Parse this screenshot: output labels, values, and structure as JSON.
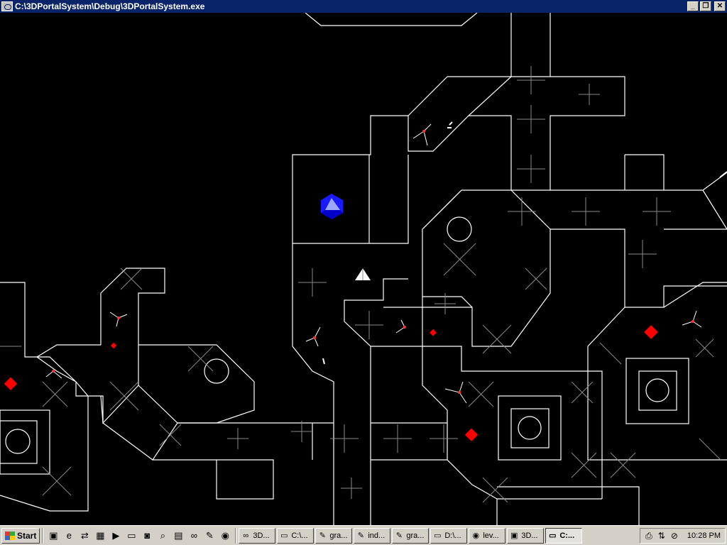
{
  "window": {
    "title": "C:\\3DPortalSystem\\Debug\\3DPortalSystem.exe",
    "minimize_label": "_",
    "maximize_label": "❐",
    "close_label": "✕"
  },
  "scene": {
    "wall_color": "#ffffff",
    "grid_color": "#8a8a8a",
    "enemy_color": "#ff0000",
    "player_color": "#1a1aff"
  },
  "taskbar": {
    "start_label": "Start",
    "quick_launch": [
      {
        "icon": "show-desktop-icon",
        "glyph": "▣"
      },
      {
        "icon": "internet-explorer-icon",
        "glyph": "e"
      },
      {
        "icon": "network-icon",
        "glyph": "⇄"
      },
      {
        "icon": "calculator-icon",
        "glyph": "▦"
      },
      {
        "icon": "media-player-icon",
        "glyph": "▶"
      },
      {
        "icon": "computer-icon",
        "glyph": "▭"
      },
      {
        "icon": "disk-icon",
        "glyph": "◙"
      },
      {
        "icon": "search-icon",
        "glyph": "⌕"
      },
      {
        "icon": "display-icon",
        "glyph": "▤"
      },
      {
        "icon": "visual-studio-icon",
        "glyph": "∞"
      },
      {
        "icon": "tools-icon",
        "glyph": "✎"
      },
      {
        "icon": "firefox-icon",
        "glyph": "◉"
      }
    ],
    "tasks": [
      {
        "label": "3D...",
        "icon": "visual-studio-icon",
        "glyph": "∞",
        "active": false
      },
      {
        "label": "C:\\...",
        "icon": "folder-icon",
        "glyph": "▭",
        "active": false
      },
      {
        "label": "gra...",
        "icon": "notepad-icon",
        "glyph": "✎",
        "active": false
      },
      {
        "label": "ind...",
        "icon": "notepad-icon",
        "glyph": "✎",
        "active": false
      },
      {
        "label": "gra...",
        "icon": "notepad-icon",
        "glyph": "✎",
        "active": false
      },
      {
        "label": "D:\\...",
        "icon": "folder-icon",
        "glyph": "▭",
        "active": false
      },
      {
        "label": "lev...",
        "icon": "firefox-icon",
        "glyph": "◉",
        "active": false
      },
      {
        "label": "3D...",
        "icon": "application-icon",
        "glyph": "▣",
        "active": false
      },
      {
        "label": "C:...",
        "icon": "console-icon",
        "glyph": "▭",
        "active": true
      }
    ],
    "tray": [
      {
        "icon": "printer-icon",
        "glyph": "⎙"
      },
      {
        "icon": "network-tray-icon",
        "glyph": "⇅"
      },
      {
        "icon": "volume-muted-icon",
        "glyph": "⊘"
      }
    ],
    "clock": "10:28 PM"
  }
}
